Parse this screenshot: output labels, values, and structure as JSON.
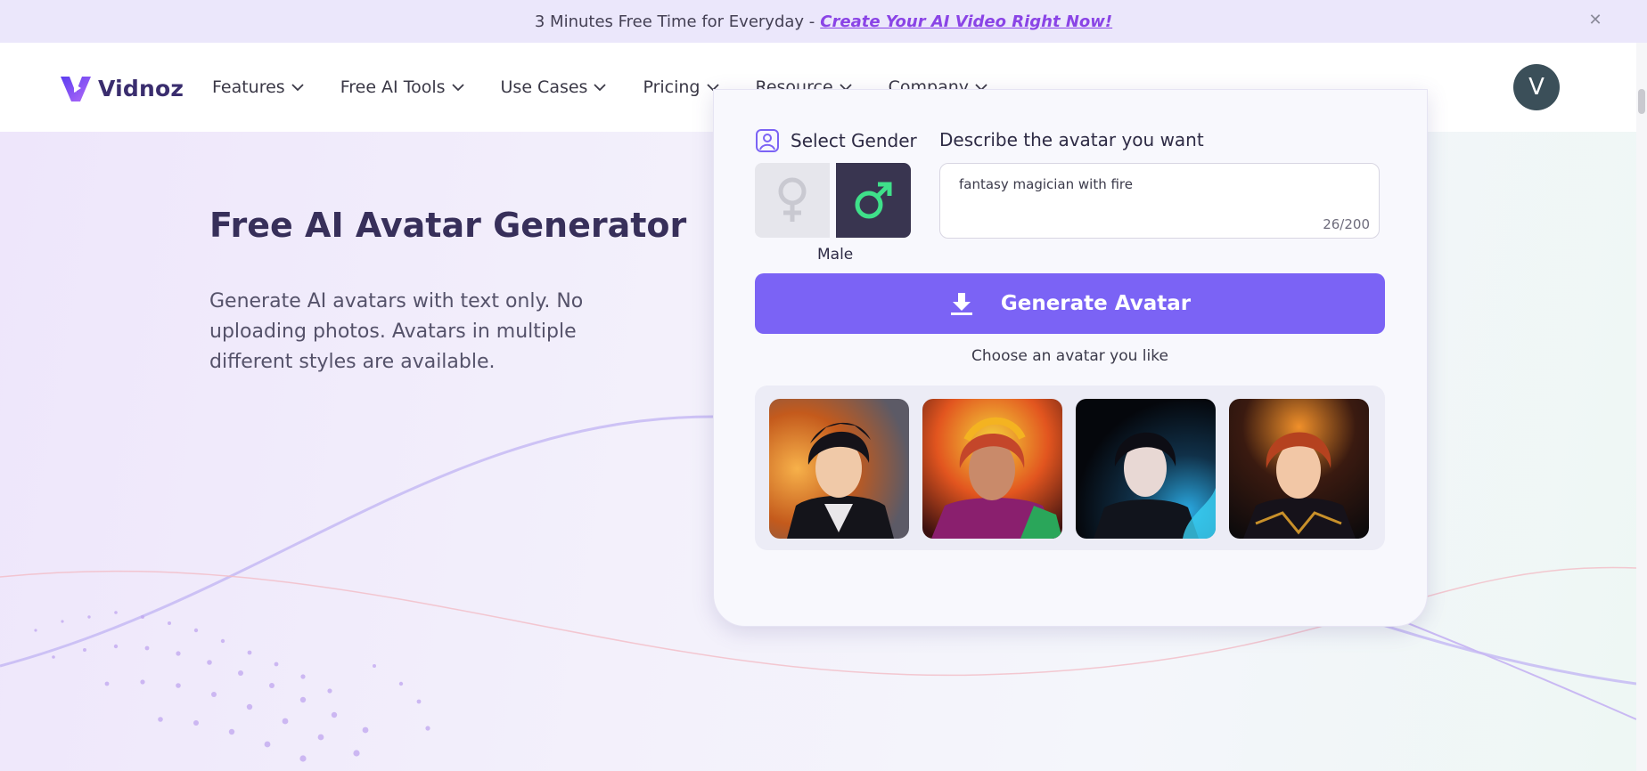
{
  "banner": {
    "text": "3 Minutes Free Time for Everyday -",
    "link": "Create Your AI Video Right Now!",
    "close_icon": "close-icon"
  },
  "header": {
    "logo_text": "Vidnoz",
    "nav": [
      {
        "label": "Features"
      },
      {
        "label": "Free AI Tools"
      },
      {
        "label": "Use Cases"
      },
      {
        "label": "Pricing"
      },
      {
        "label": "Resource"
      },
      {
        "label": "Company"
      }
    ],
    "user_initial": "V"
  },
  "hero": {
    "title": "Free AI Avatar Generator",
    "description": "Generate AI avatars with text only. No uploading photos. Avatars in multiple different styles are available."
  },
  "generator": {
    "gender_label": "Select Gender",
    "selected_gender": "Male",
    "describe_label": "Describe the avatar you want",
    "prompt_text": "fantasy magician with fire",
    "char_count": "26/200",
    "generate_label": "Generate Avatar",
    "choose_label": "Choose an avatar you like",
    "avatars": [
      {
        "name": "avatar-1",
        "hair": "#151219",
        "accent": "#f08a24"
      },
      {
        "name": "avatar-2",
        "hair": "#c4462a",
        "accent": "#f4b321"
      },
      {
        "name": "avatar-3",
        "hair": "#0d0d14",
        "accent": "#2aa8e0"
      },
      {
        "name": "avatar-4",
        "hair": "#b5421f",
        "accent": "#f0902a"
      }
    ]
  },
  "colors": {
    "accent": "#7b63f5",
    "brand": "#3a2d6e",
    "male_selected_bg": "#393550",
    "male_icon": "#3fe08a"
  }
}
